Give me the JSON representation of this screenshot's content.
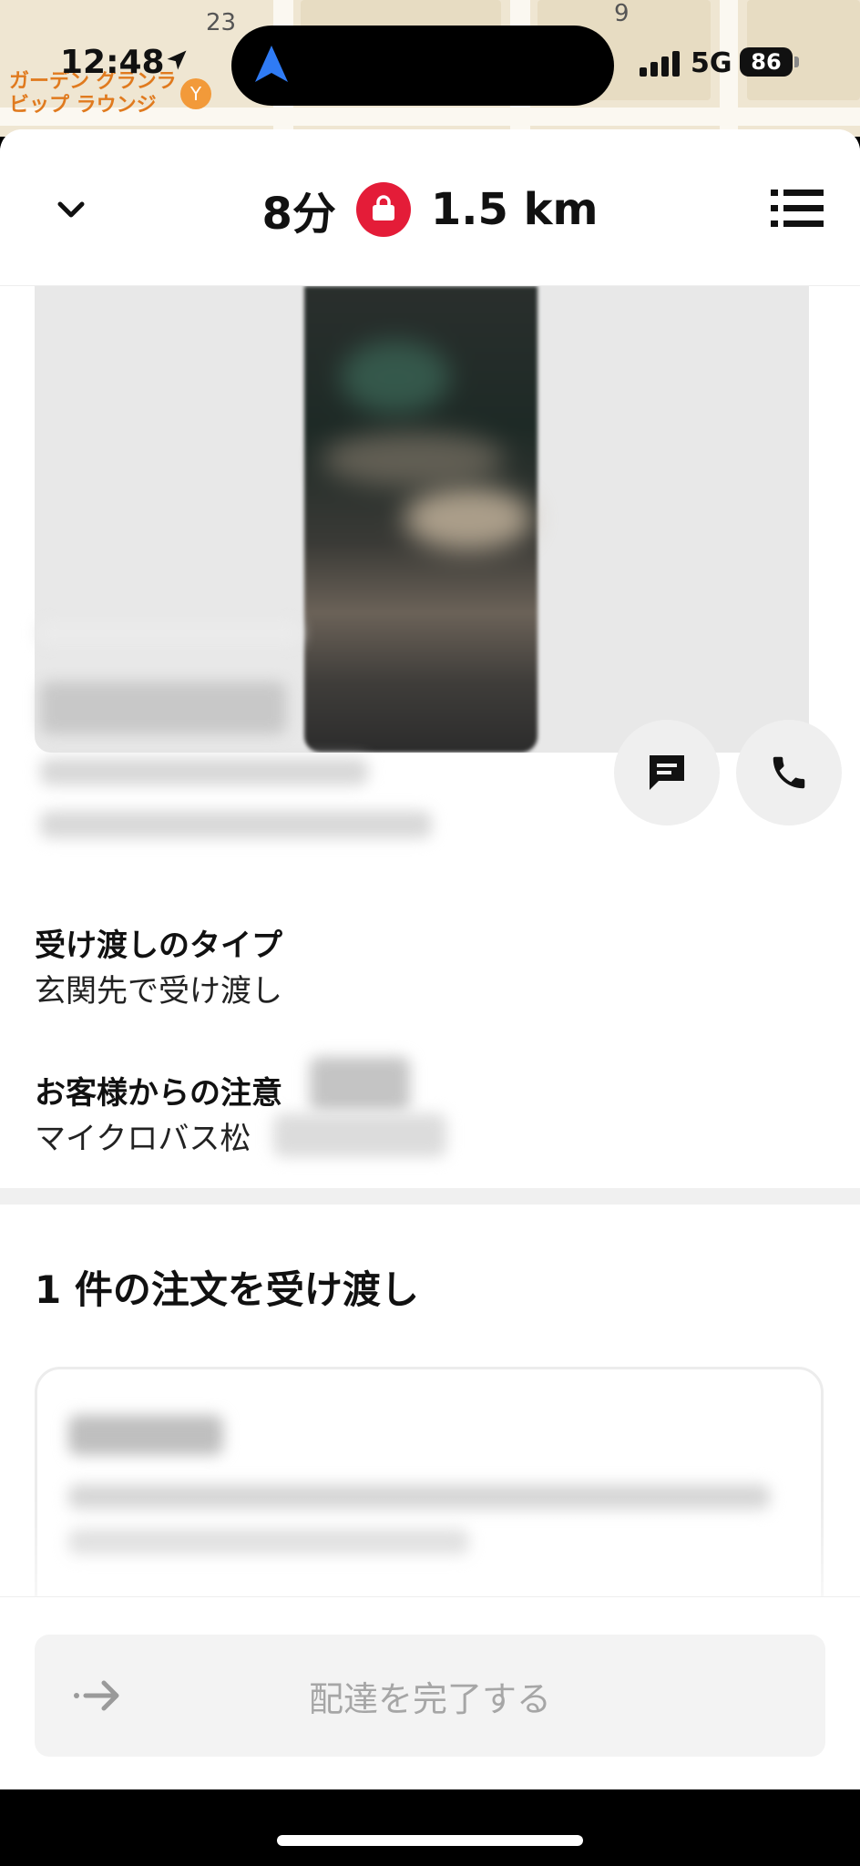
{
  "status_bar": {
    "time": "12:48",
    "network": "5G",
    "battery": "86"
  },
  "map": {
    "block_numbers": [
      "23",
      "9"
    ],
    "poi_line1": "ガーデン グランラ",
    "poi_line2": "ビップ ラウンジ",
    "poi_icon": "cocktail-icon"
  },
  "header": {
    "eta": "8分",
    "distance": "1.5 km",
    "collapse_icon": "chevron-down-icon",
    "menu_icon": "list-icon",
    "badge_icon": "shopping-bag-icon",
    "badge_color": "#e41c38"
  },
  "customer": {
    "message_icon": "chat-icon",
    "call_icon": "phone-icon"
  },
  "delivery": {
    "handoff_type_label": "受け渡しのタイプ",
    "handoff_type_value": "玄関先で受け渡し",
    "notes_label": "お客様からの注意",
    "notes_value": "マイクロバス松"
  },
  "orders": {
    "title": "1 件の注文を受け渡し"
  },
  "action": {
    "complete_label": "配達を完了する",
    "arrow_icon": "arrow-right-icon"
  }
}
